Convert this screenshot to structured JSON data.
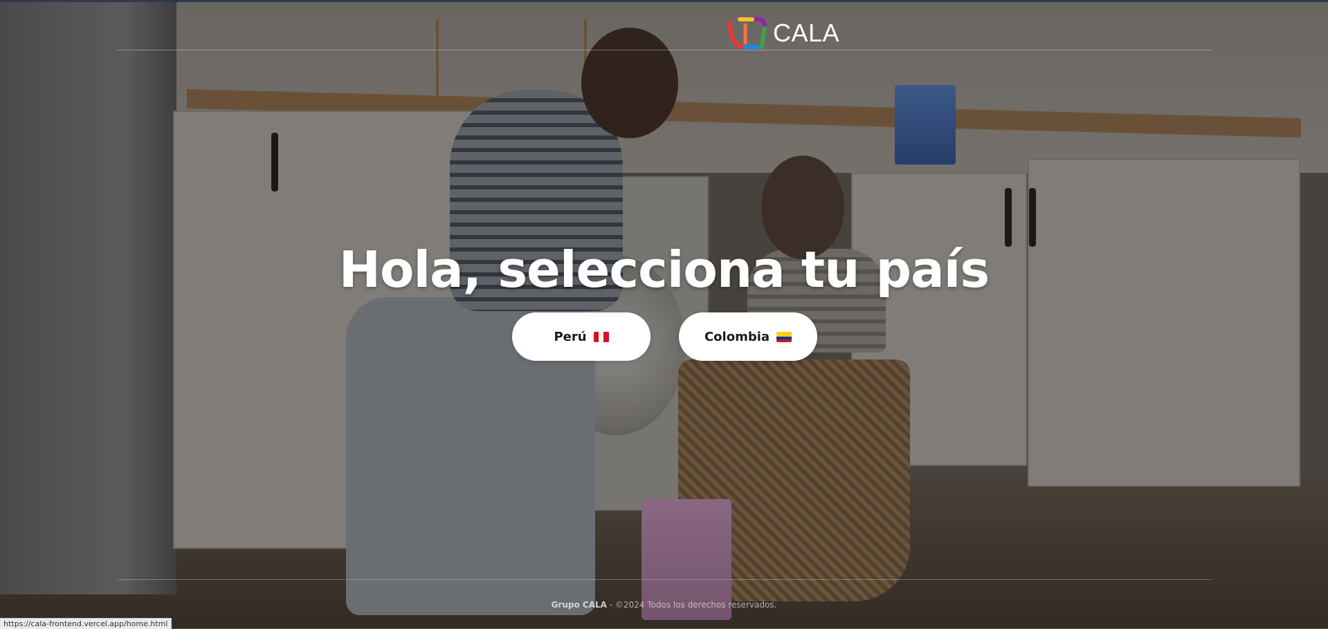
{
  "brand": {
    "name": "CALA",
    "logo_colors": [
      "#e53935",
      "#fbc02d",
      "#43a047",
      "#1e88e5",
      "#8e24aa",
      "#ff7043"
    ]
  },
  "hero": {
    "title": "Hola, selecciona tu país"
  },
  "countries": [
    {
      "label": "Perú",
      "flag_colors": [
        "#d91023",
        "#ffffff",
        "#d91023"
      ]
    },
    {
      "label": "Colombia",
      "flag_colors": [
        "#fcd116",
        "#003893",
        "#ce1126"
      ]
    }
  ],
  "footer": {
    "company": "Grupo CALA",
    "rights": " - ©2024 Todos los derechos reservados."
  },
  "status_bar": {
    "url": "https://cala-frontend.vercel.app/home.html"
  }
}
